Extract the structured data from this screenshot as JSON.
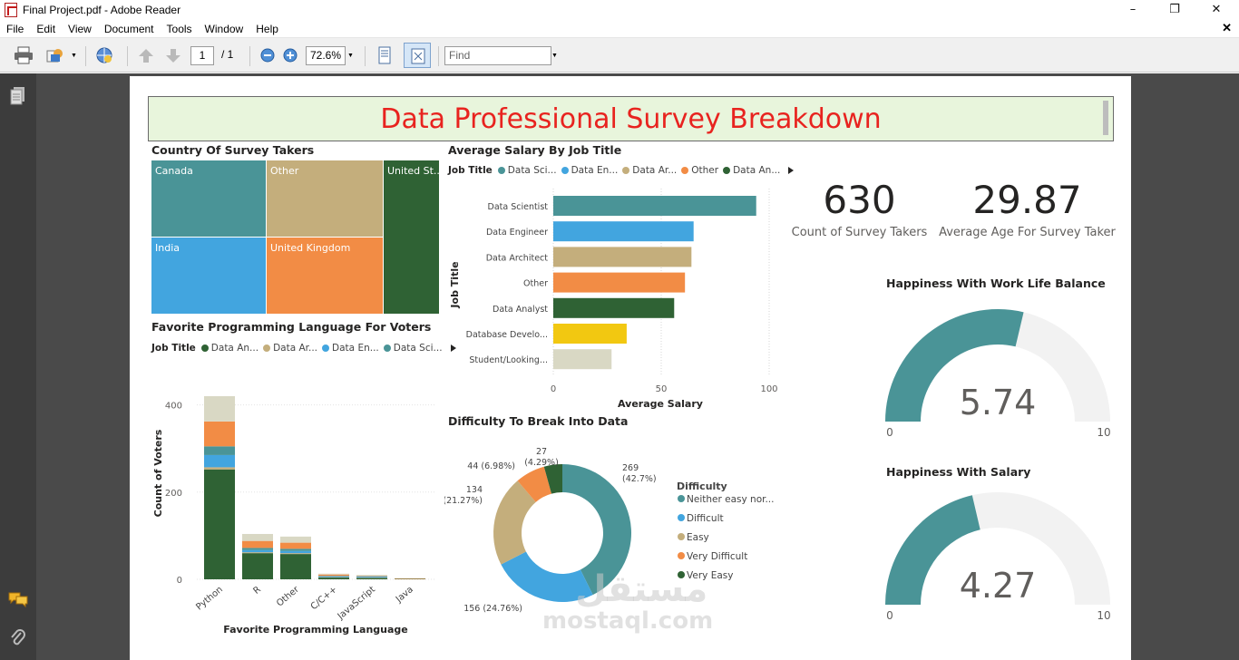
{
  "window": {
    "title": "Final Project.pdf - Adobe Reader"
  },
  "menu": [
    "File",
    "Edit",
    "View",
    "Document",
    "Tools",
    "Window",
    "Help"
  ],
  "toolbar": {
    "page_current": "1",
    "page_total": "/ 1",
    "zoom": "72.6%",
    "find_placeholder": "Find"
  },
  "dashboard": {
    "title": "Data Professional Survey Breakdown",
    "country": {
      "title": "Country Of Survey Takers",
      "tiles": [
        {
          "label": "Canada",
          "color": "#4a9497"
        },
        {
          "label": "Other",
          "color": "#c4ae7c"
        },
        {
          "label": "United St...",
          "color": "#2f6234"
        },
        {
          "label": "India",
          "color": "#42a5df"
        },
        {
          "label": "United Kingdom",
          "color": "#f28c45"
        }
      ]
    },
    "salary": {
      "title": "Average Salary By Job Title",
      "legend_title": "Job Title",
      "legend": [
        {
          "label": "Data Sci...",
          "color": "#4a9497"
        },
        {
          "label": "Data En...",
          "color": "#42a5df"
        },
        {
          "label": "Data Ar...",
          "color": "#c4ae7c"
        },
        {
          "label": "Other",
          "color": "#f28c45"
        },
        {
          "label": "Data An...",
          "color": "#2f6234"
        }
      ]
    },
    "language": {
      "title": "Favorite Programming Language For Voters",
      "legend_title": "Job Title",
      "legend": [
        {
          "label": "Data An...",
          "color": "#2f6234"
        },
        {
          "label": "Data Ar...",
          "color": "#c4ae7c"
        },
        {
          "label": "Data En...",
          "color": "#42a5df"
        },
        {
          "label": "Data Sci...",
          "color": "#4a9497"
        }
      ]
    },
    "difficulty": {
      "title": "Difficulty To Break Into Data",
      "legend_title": "Difficulty"
    },
    "kpis": [
      {
        "value": "630",
        "label": "Count of Survey Takers"
      },
      {
        "value": "29.87",
        "label": "Average Age For Survey Taker"
      }
    ],
    "gauges": [
      {
        "title": "Happiness With Work Life Balance",
        "value": 5.74,
        "value_label": "5.74",
        "min": 0,
        "max": 10,
        "min_label": "0",
        "max_label": "10"
      },
      {
        "title": "Happiness With Salary",
        "value": 4.27,
        "value_label": "4.27",
        "min": 0,
        "max": 10,
        "min_label": "0",
        "max_label": "10"
      }
    ]
  },
  "watermark": {
    "arabic": "مستقل",
    "latin": "mostaql.com"
  },
  "chart_data": [
    {
      "type": "bar",
      "orientation": "horizontal",
      "title": "Average Salary By Job Title",
      "xlabel": "Average Salary",
      "ylabel": "Job Title",
      "xlim": [
        0,
        100
      ],
      "xticks": [
        "0",
        "50",
        "100"
      ],
      "categories": [
        "Data Scientist",
        "Data Engineer",
        "Data Architect",
        "Other",
        "Data Analyst",
        "Database Develo...",
        "Student/Looking..."
      ],
      "values": [
        94,
        65,
        64,
        61,
        56,
        34,
        27
      ],
      "colors": [
        "#4a9497",
        "#42a5df",
        "#c4ae7c",
        "#f28c45",
        "#2f6234",
        "#f2c811",
        "#d9d8c4"
      ]
    },
    {
      "type": "bar",
      "stacked": true,
      "title": "Favorite Programming Language For Voters",
      "xlabel": "Favorite Programming Language",
      "ylabel": "Count of Voters",
      "ylim": [
        0,
        420
      ],
      "yticks": [
        "0",
        "200",
        "400"
      ],
      "categories": [
        "Python",
        "R",
        "Other",
        "C/C++",
        "JavaScript",
        "Java"
      ],
      "series": [
        {
          "name": "Data An...",
          "color": "#2f6234",
          "values": [
            252,
            60,
            58,
            4,
            3,
            1
          ]
        },
        {
          "name": "Data Ar...",
          "color": "#c4ae7c",
          "values": [
            5,
            2,
            2,
            1,
            1,
            0
          ]
        },
        {
          "name": "Data En...",
          "color": "#42a5df",
          "values": [
            28,
            5,
            5,
            2,
            2,
            0
          ]
        },
        {
          "color": "#4a9497",
          "values": [
            20,
            5,
            5,
            1,
            1,
            0
          ]
        },
        {
          "color": "#f28c45",
          "values": [
            57,
            16,
            14,
            3,
            1,
            1
          ]
        },
        {
          "color": "#d9d8c4",
          "values": [
            58,
            16,
            14,
            2,
            2,
            0
          ]
        }
      ]
    },
    {
      "type": "pie",
      "donut": true,
      "title": "Difficulty To Break Into Data",
      "slices": [
        {
          "name": "Neither easy nor...",
          "value": 269,
          "label": "269",
          "pct_label": "(42.7%)",
          "color": "#4a9497"
        },
        {
          "name": "Difficult",
          "value": 156,
          "label": "156 (24.76%)",
          "color": "#42a5df"
        },
        {
          "name": "Easy",
          "value": 134,
          "label": "134",
          "pct_label": "(21.27%)",
          "color": "#c4ae7c"
        },
        {
          "name": "Very Difficult",
          "value": 44,
          "label": "44 (6.98%)",
          "color": "#f28c45"
        },
        {
          "name": "Very Easy",
          "value": 27,
          "label": "27",
          "pct_label": "(4.29%)",
          "color": "#2f6234"
        }
      ]
    },
    {
      "type": "treemap",
      "title": "Country Of Survey Takers",
      "categories": [
        "United States",
        "India",
        "United Kingdom",
        "Canada",
        "Other"
      ]
    }
  ]
}
